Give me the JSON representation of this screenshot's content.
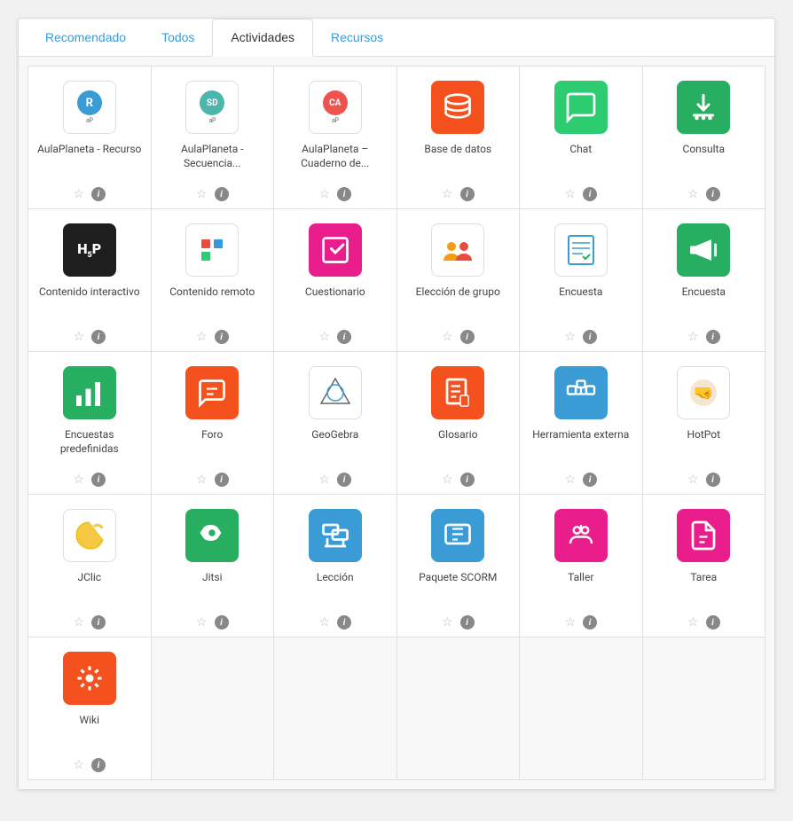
{
  "tabs": [
    {
      "id": "recomendado",
      "label": "Recomendado",
      "active": false
    },
    {
      "id": "todos",
      "label": "Todos",
      "active": false
    },
    {
      "id": "actividades",
      "label": "Actividades",
      "active": true
    },
    {
      "id": "recursos",
      "label": "Recursos",
      "active": false
    }
  ],
  "items": [
    {
      "id": "aulap-recurso",
      "label": "AulaPlaneta - Recurso",
      "type": "aulap",
      "color": "#3a9bd5",
      "letter": "R"
    },
    {
      "id": "aulap-secuencia",
      "label": "AulaPlaneta - Secuencia...",
      "type": "aulap",
      "color": "#4db6ac",
      "letter": "SD"
    },
    {
      "id": "aulap-cuaderno",
      "label": "AulaPlaneta – Cuaderno de...",
      "type": "aulap",
      "color": "#ef5350",
      "letter": "CA"
    },
    {
      "id": "base-datos",
      "label": "Base de datos",
      "type": "icon",
      "color": "#f4511e",
      "icon": "database"
    },
    {
      "id": "chat",
      "label": "Chat",
      "type": "icon",
      "color": "#2ecc71",
      "icon": "chat"
    },
    {
      "id": "consulta",
      "label": "Consulta",
      "type": "icon",
      "color": "#27ae60",
      "icon": "fork"
    },
    {
      "id": "contenido-interactivo",
      "label": "Contenido interactivo",
      "type": "h5p",
      "color": "#1e1e1e"
    },
    {
      "id": "contenido-remoto",
      "label": "Contenido remoto",
      "type": "icon",
      "color": "#fff",
      "icon": "shapes",
      "dark": true
    },
    {
      "id": "cuestionario",
      "label": "Cuestionario",
      "type": "icon",
      "color": "#e91e8c",
      "icon": "check-square"
    },
    {
      "id": "eleccion-grupo",
      "label": "Elección de grupo",
      "type": "icon",
      "color": "#fff",
      "icon": "group",
      "dark": true
    },
    {
      "id": "encuesta-1",
      "label": "Encuesta",
      "type": "icon",
      "color": "#fff",
      "icon": "survey",
      "dark": true
    },
    {
      "id": "encuesta-2",
      "label": "Encuesta",
      "type": "icon",
      "color": "#27ae60",
      "icon": "megaphone"
    },
    {
      "id": "encuestas-pre",
      "label": "Encuestas predefinidas",
      "type": "icon",
      "color": "#27ae60",
      "icon": "bar-chart"
    },
    {
      "id": "foro",
      "label": "Foro",
      "type": "icon",
      "color": "#f4511e",
      "icon": "forum"
    },
    {
      "id": "geogebra",
      "label": "GeoGebra",
      "type": "icon",
      "color": "#fff",
      "icon": "hexagon",
      "dark": true
    },
    {
      "id": "glosario",
      "label": "Glosario",
      "type": "icon",
      "color": "#f4511e",
      "icon": "book-open"
    },
    {
      "id": "herramienta-ext",
      "label": "Herramienta externa",
      "type": "icon",
      "color": "#3a9bd5",
      "icon": "puzzle"
    },
    {
      "id": "hotpot",
      "label": "HotPot",
      "type": "icon",
      "color": "#fff",
      "icon": "fist",
      "dark": true
    },
    {
      "id": "jclic",
      "label": "JClic",
      "type": "icon",
      "color": "#fff",
      "icon": "jclic",
      "dark": true
    },
    {
      "id": "jitsi",
      "label": "Jitsi",
      "type": "icon",
      "color": "#27ae60",
      "icon": "jitsi"
    },
    {
      "id": "leccion",
      "label": "Lección",
      "type": "icon",
      "color": "#3a9bd5",
      "icon": "lesson"
    },
    {
      "id": "paquete-scorm",
      "label": "Paquete SCORM",
      "type": "icon",
      "color": "#3a9bd5",
      "icon": "scorm"
    },
    {
      "id": "taller",
      "label": "Taller",
      "type": "icon",
      "color": "#e91e8c",
      "icon": "taller"
    },
    {
      "id": "tarea",
      "label": "Tarea",
      "type": "icon",
      "color": "#e91e8c",
      "icon": "tarea"
    },
    {
      "id": "wiki",
      "label": "Wiki",
      "type": "icon",
      "color": "#f4511e",
      "icon": "wiki"
    }
  ]
}
